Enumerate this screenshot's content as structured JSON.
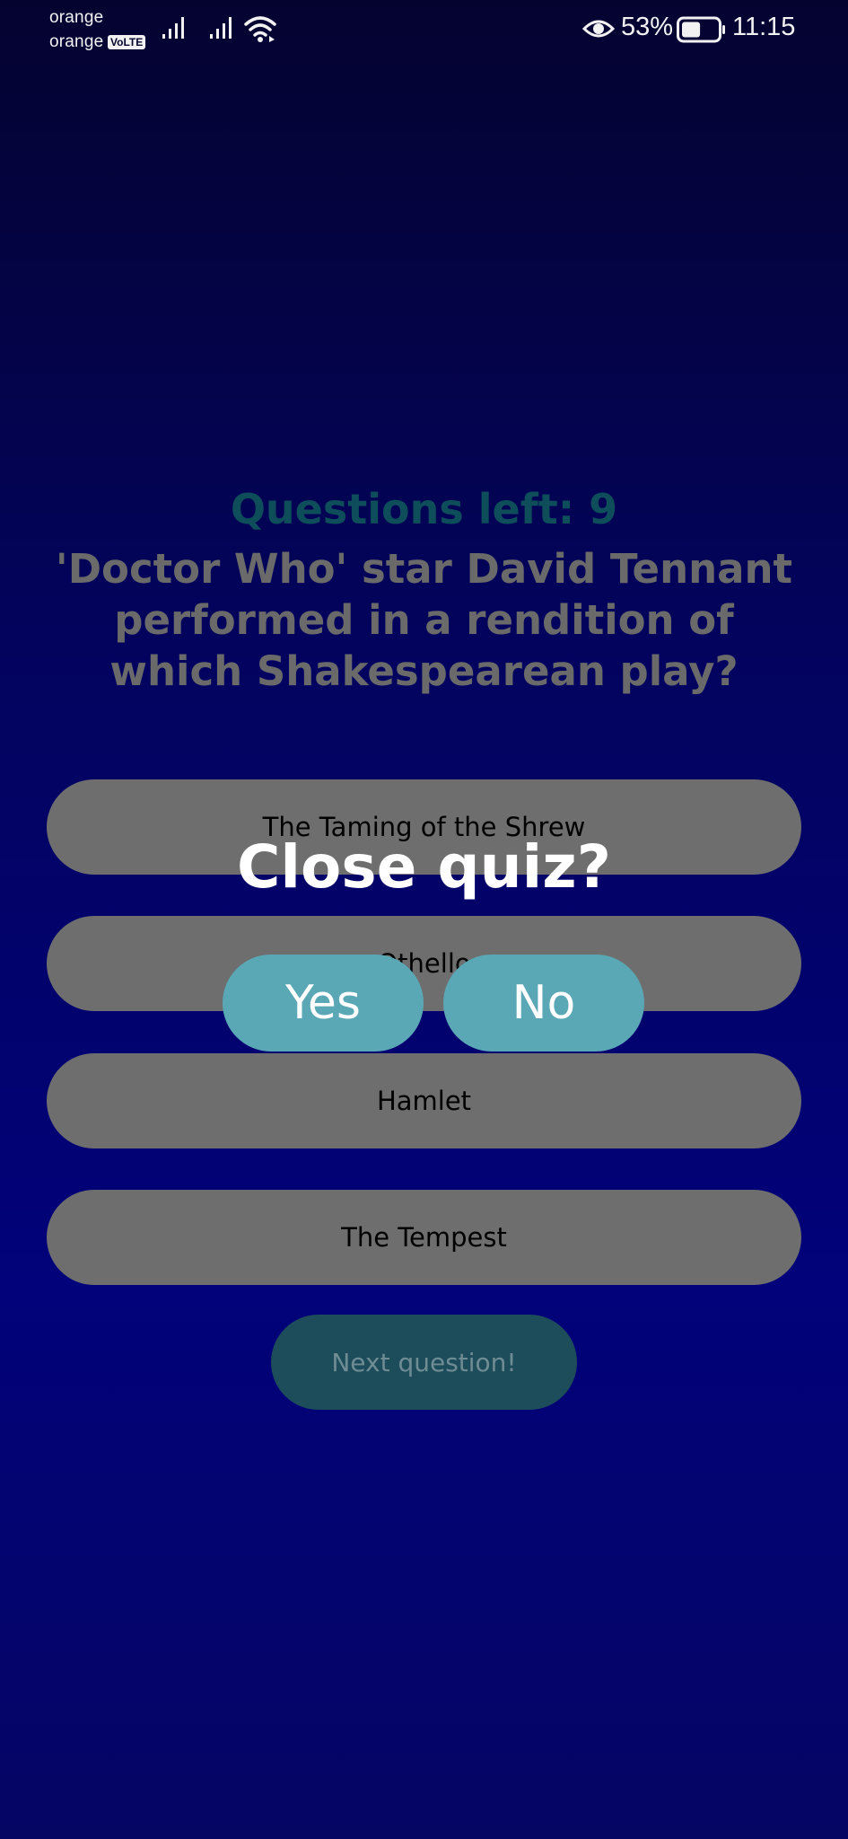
{
  "status_bar": {
    "carrier_line1": "orange",
    "carrier_line2": "orange",
    "volte_badge": "VoLTE",
    "battery_percent": "53%",
    "battery_level": 0.53,
    "time": "11:15"
  },
  "quiz": {
    "questions_left": "Questions left: 9",
    "question": "'Doctor Who' star David Tennant performed in a rendition of which Shakespearean play?",
    "answers": [
      "The Taming of the Shrew",
      "Othello",
      "Hamlet",
      "The Tempest"
    ],
    "next_button": "Next question!"
  },
  "dialog": {
    "title": "Close quiz?",
    "yes_label": "Yes",
    "no_label": "No"
  },
  "colors": {
    "accent": "#5aa8b5",
    "background_top": "#040330",
    "background_bottom": "#02027a",
    "answer_button": "#6e6e6e"
  }
}
